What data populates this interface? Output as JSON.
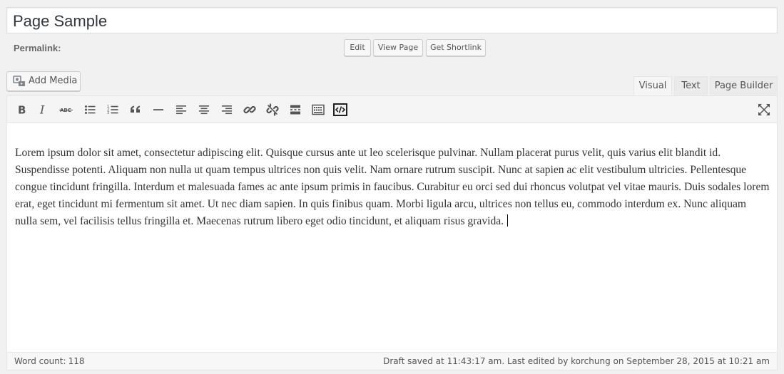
{
  "post": {
    "title": "Page Sample"
  },
  "permalink": {
    "label": "Permalink:",
    "edit_label": "Edit",
    "view_label": "View Page",
    "shortlink_label": "Get Shortlink"
  },
  "media": {
    "add_label": "Add Media",
    "icon": "media-icon"
  },
  "tabs": [
    {
      "label": "Visual",
      "active": true
    },
    {
      "label": "Text",
      "active": false
    },
    {
      "label": "Page Builder",
      "active": false
    }
  ],
  "toolbar": {
    "buttons": [
      "bold-icon",
      "italic-icon",
      "strikethrough-icon",
      "bullet-list-icon",
      "numbered-list-icon",
      "blockquote-icon",
      "horizontal-rule-icon",
      "align-left-icon",
      "align-center-icon",
      "align-right-icon",
      "link-icon",
      "unlink-icon",
      "read-more-icon",
      "toolbar-toggle-icon",
      "shortcode-icon",
      "fullscreen-icon"
    ]
  },
  "content": {
    "text": "Lorem ipsum dolor sit amet, consectetur adipiscing elit. Quisque cursus ante ut leo scelerisque pulvinar. Nullam placerat purus velit, quis varius elit blandit id. Suspendisse potenti. Aliquam non nulla ut quam tempus ultrices non quis velit. Nam ornare rutrum suscipit. Nunc at sapien ac elit vestibulum ultricies. Pellentesque congue tincidunt fringilla. Interdum et malesuada fames ac ante ipsum primis in faucibus. Curabitur eu orci sed dui rhoncus volutpat vel vitae mauris. Duis sodales lorem erat, eget tincidunt mi fermentum sit amet. Ut nec diam sapien. In quis finibus quam. Morbi ligula arcu, ultrices non tellus eu, commodo interdum ex. Nunc aliquam nulla sem, vel facilisis tellus fringilla et. Maecenas rutrum libero eget odio tincidunt, et aliquam risus gravida."
  },
  "status": {
    "word_count_label": "Word count:",
    "word_count": "118",
    "draft_text": "Draft saved at 11:43:17 am. Last edited by korchung on September 28, 2015 at 10:21 am"
  }
}
